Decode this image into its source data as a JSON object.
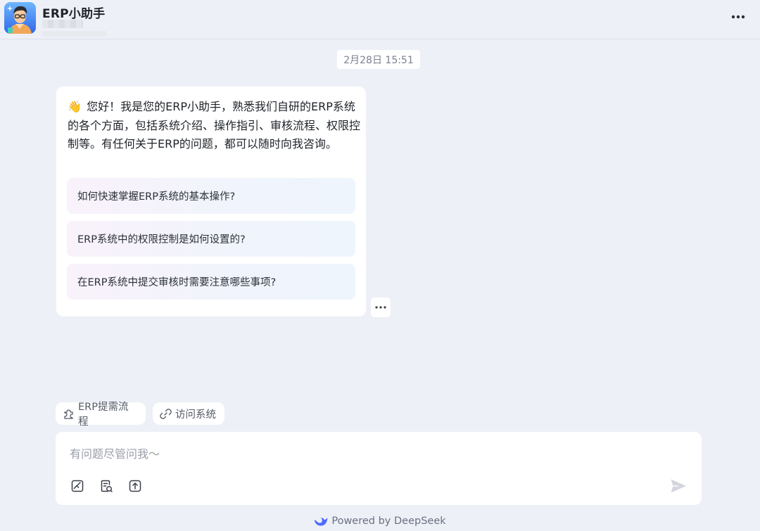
{
  "header": {
    "title": "ERP小助手",
    "avatar_icon": "robot-avatar",
    "more_icon": "more-horizontal-icon"
  },
  "conversation": {
    "timestamp": "2月28日 15:51",
    "message": {
      "emoji": "👋",
      "text": "您好！我是您的ERP小助手，熟悉我们自研的ERP系统的各个方面，包括系统介绍、操作指引、审核流程、权限控制等。有任何关于ERP的问题，都可以随时向我咨询。",
      "suggestions": [
        "如何快速掌握ERP系统的基本操作?",
        "ERP系统中的权限控制是如何设置的?",
        "在ERP系统中提交审核时需要注意哪些事项?"
      ]
    }
  },
  "quick_actions": [
    {
      "label": "ERP提需流程",
      "icon": "puzzle-icon"
    },
    {
      "label": "访问系统",
      "icon": "link-icon"
    }
  ],
  "input": {
    "placeholder": "有问题尽管问我～",
    "value": "",
    "tools": [
      "image-icon",
      "document-icon",
      "upload-icon"
    ],
    "send_icon": "send-icon"
  },
  "footer": {
    "text": "Powered by DeepSeek",
    "brand_color": "#4d6bfe"
  },
  "colors": {
    "background": "#eef0f7",
    "card": "#ffffff",
    "muted_text": "#9a9ea8"
  }
}
